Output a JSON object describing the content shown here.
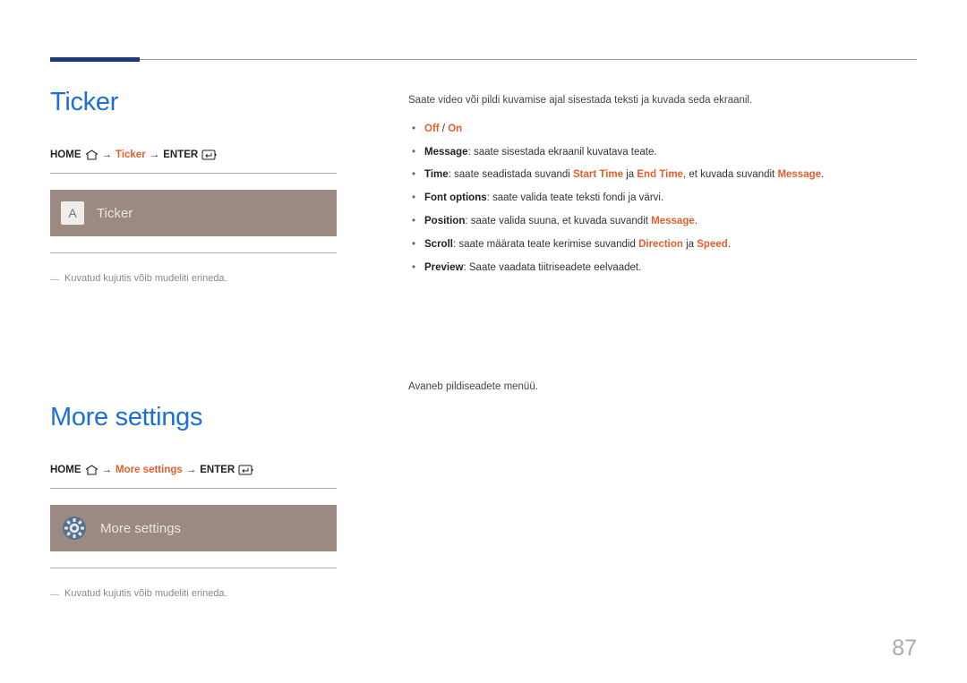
{
  "page_number": "87",
  "ticker": {
    "heading": "Ticker",
    "nav": {
      "home": "HOME",
      "middle": "Ticker",
      "enter": "ENTER",
      "arrow": "→"
    },
    "tile_label": "Ticker",
    "tile_badge": "A",
    "note": "Kuvatud kujutis võib mudeliti erineda.",
    "intro": "Saate video või pildi kuvamise ajal sisestada teksti ja kuvada seda ekraanil.",
    "items": {
      "off_on": {
        "off": "Off",
        "sep": " / ",
        "on": "On"
      },
      "message": {
        "label": "Message",
        "desc": ": saate sisestada ekraanil kuvatava teate."
      },
      "time": {
        "label": "Time",
        "p1": ": saate seadistada suvandi ",
        "k1": "Start Time",
        "p2": " ja ",
        "k2": "End Time",
        "p3": ", et kuvada suvandit ",
        "k3": "Message",
        "p4": "."
      },
      "font": {
        "label": "Font options",
        "desc": ": saate valida teate teksti fondi ja värvi."
      },
      "position": {
        "label": "Position",
        "p1": ": saate valida suuna, et kuvada suvandit ",
        "k1": "Message",
        "p2": "."
      },
      "scroll": {
        "label": "Scroll",
        "p1": ": saate määrata teate kerimise suvandid ",
        "k1": "Direction",
        "p2": " ja ",
        "k2": "Speed",
        "p3": "."
      },
      "preview": {
        "label": "Preview",
        "desc": ": Saate vaadata tiitriseadete eelvaadet."
      }
    }
  },
  "more_settings": {
    "heading": "More settings",
    "nav": {
      "home": "HOME",
      "middle": "More settings",
      "enter": "ENTER",
      "arrow": "→"
    },
    "tile_label": "More settings",
    "note": "Kuvatud kujutis võib mudeliti erineda.",
    "intro": "Avaneb pildiseadete menüü."
  }
}
